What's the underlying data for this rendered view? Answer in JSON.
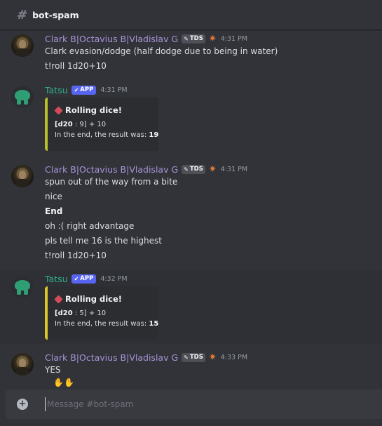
{
  "channel": {
    "name": "bot-spam",
    "icon": "hash-icon"
  },
  "messages": [
    {
      "author": "Clark B|Octavius B|Vladislav G",
      "tag": "TDS",
      "time": "4:31 PM",
      "lines": [
        "Clark evasion/dodge (half dodge due to being in water)",
        "t!roll 1d20+10"
      ]
    },
    {
      "author": "Tatsu",
      "tag": "APP",
      "time": "4:31 PM",
      "embed": {
        "title": "Rolling dice!",
        "roll_prefix": "[",
        "roll_die": "d20",
        "roll_rest": " : 9] + 10",
        "result_label": "In the end, the result was: ",
        "result_value": "19"
      }
    },
    {
      "author": "Clark B|Octavius B|Vladislav G",
      "tag": "TDS",
      "time": "4:31 PM",
      "lines": [
        "spun out of the way from a bite",
        "nice",
        "End",
        "oh :( right advantage",
        "pls tell me 16 is the highest",
        "t!roll 1d20+10"
      ]
    },
    {
      "author": "Tatsu",
      "tag": "APP",
      "time": "4:32 PM",
      "embed": {
        "title": "Rolling dice!",
        "roll_prefix": "[",
        "roll_die": "d20",
        "roll_rest": " : 5] + 10",
        "result_label": "In the end, the result was: ",
        "result_value": "15"
      }
    },
    {
      "author": "Clark B|Octavius B|Vladislav G",
      "tag": "TDS",
      "time": "4:33 PM",
      "lines": [
        "YES"
      ]
    }
  ],
  "composer": {
    "placeholder": "Message #bot-spam",
    "value": ""
  },
  "colors": {
    "background": "#313338",
    "bot_name": "#2fb08c",
    "user_name": "#a894d8",
    "app_badge": "#5865f2"
  }
}
